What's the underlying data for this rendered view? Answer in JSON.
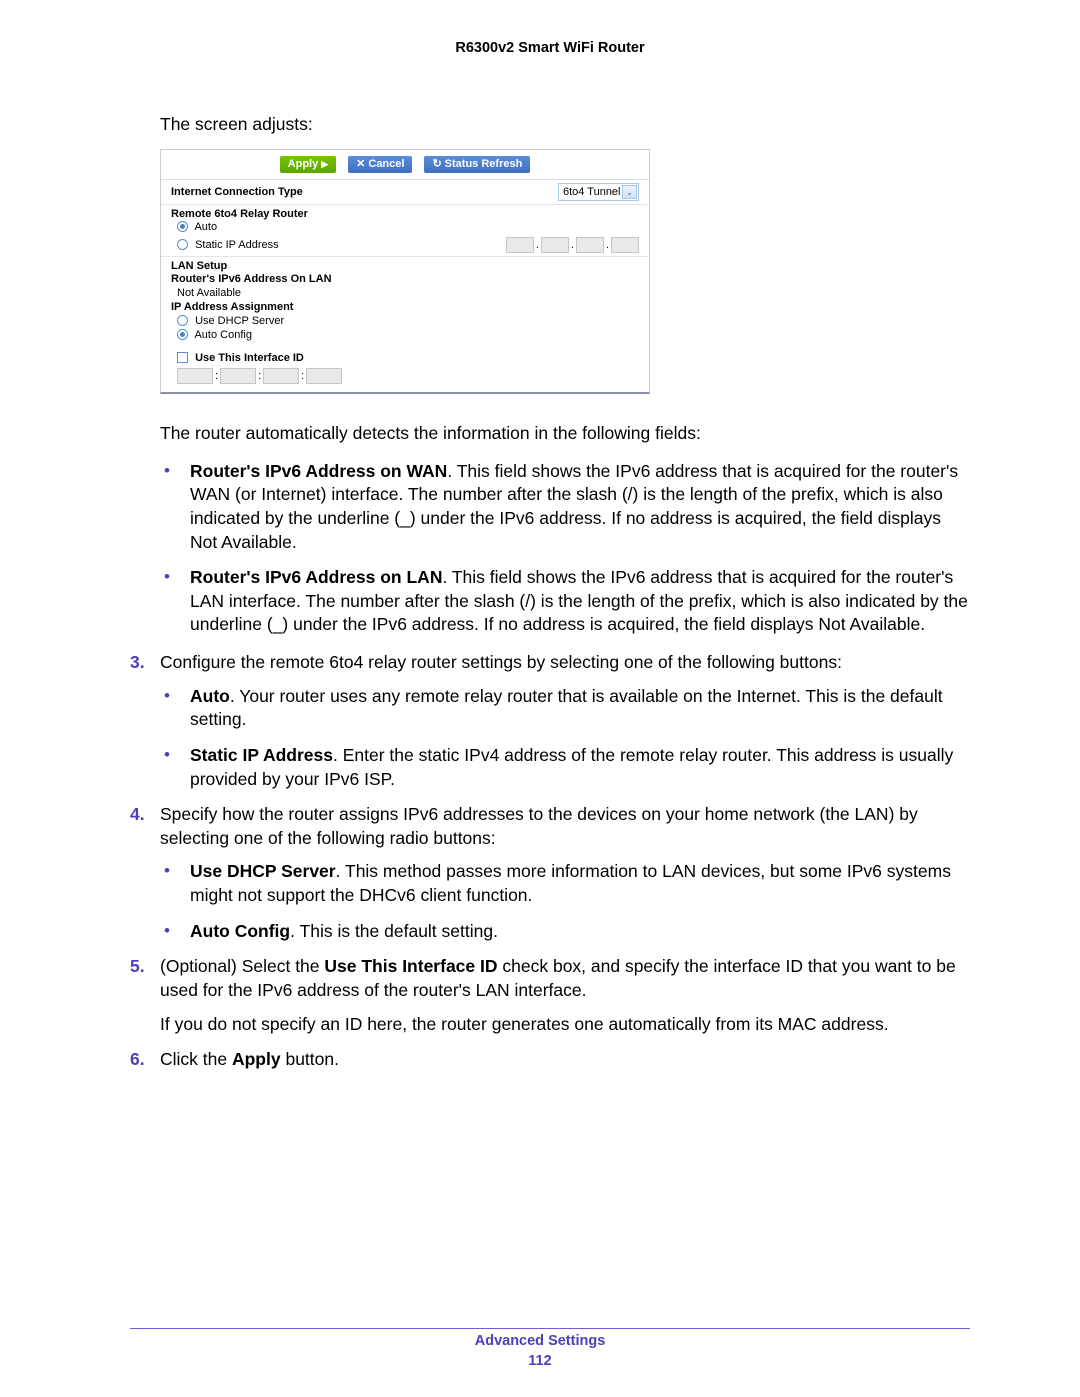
{
  "header": {
    "title": "R6300v2 Smart WiFi Router"
  },
  "intro": "The screen adjusts:",
  "panel": {
    "buttons": {
      "apply": "Apply",
      "cancel": "Cancel",
      "refresh": "Status Refresh"
    },
    "conn_type_label": "Internet Connection Type",
    "conn_type_value": "6to4 Tunnel",
    "relay_header": "Remote 6to4 Relay Router",
    "relay_auto": "Auto",
    "relay_static": "Static IP Address",
    "lan_header": "LAN Setup",
    "lan_addr_label": "Router's IPv6 Address On LAN",
    "lan_addr_value": "Not Available",
    "assign_label": "IP Address Assignment",
    "assign_dhcp": "Use DHCP Server",
    "assign_auto": "Auto Config",
    "iface_label": "Use This Interface ID"
  },
  "afterPanel": "The router automatically detects the information in the following fields:",
  "detect_bullets": [
    {
      "bold": "Router's IPv6 Address on WAN",
      "text": ". This field shows the IPv6 address that is acquired for the router's WAN (or Internet) interface. The number after the slash (/) is the length of the prefix, which is also indicated by the underline (_) under the IPv6 address. If no address is acquired, the field displays Not Available."
    },
    {
      "bold": "Router's IPv6 Address on LAN",
      "text": ". This field shows the IPv6 address that is acquired for the router's LAN interface. The number after the slash (/) is the length of the prefix, which is also indicated by the underline (_) under the IPv6 address. If no address is acquired, the field displays Not Available."
    }
  ],
  "steps": {
    "s3": {
      "num": "3.",
      "lead": "Configure the remote 6to4 relay router settings by selecting one of the following buttons:",
      "bullets": [
        {
          "bold": "Auto",
          "text": ". Your router uses any remote relay router that is available on the Internet. This is the default setting."
        },
        {
          "bold": "Static IP Address",
          "text": ". Enter the static IPv4 address of the remote relay router. This address is usually provided by your IPv6 ISP."
        }
      ]
    },
    "s4": {
      "num": "4.",
      "lead": "Specify how the router assigns IPv6 addresses to the devices on your home network (the LAN) by selecting one of the following radio buttons:",
      "bullets": [
        {
          "bold": "Use DHCP Server",
          "text": ". This method passes more information to LAN devices, but some IPv6 systems might not support the DHCv6 client function."
        },
        {
          "bold": "Auto Config",
          "text": ". This is the default setting."
        }
      ]
    },
    "s5": {
      "num": "5.",
      "pre": "(Optional) Select the ",
      "bold": "Use This Interface ID",
      "post": " check box, and specify the interface ID that you want to be used for the IPv6 address of the router's LAN interface.",
      "note": "If you do not specify an ID here, the router generates one automatically from its MAC address."
    },
    "s6": {
      "num": "6.",
      "pre": "Click the ",
      "bold": "Apply",
      "post": " button."
    }
  },
  "footer": {
    "section": "Advanced Settings",
    "page": "112"
  }
}
